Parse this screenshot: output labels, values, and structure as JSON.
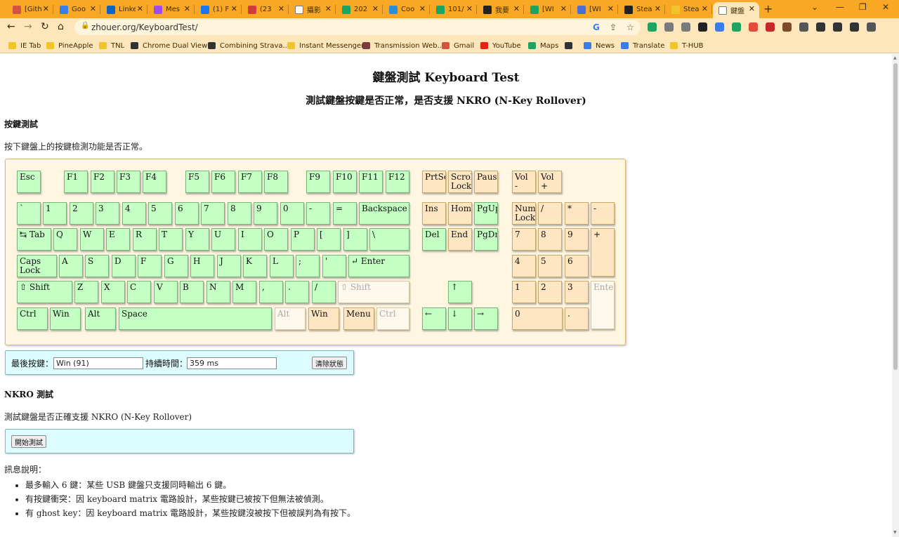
{
  "browser": {
    "tabs": [
      {
        "title": "[Gith",
        "color": "#d4523f"
      },
      {
        "title": "Goo",
        "color": "#3b7de8"
      },
      {
        "title": "Linke",
        "color": "#0a66c2"
      },
      {
        "title": "Mes",
        "color": "#a04bf0"
      },
      {
        "title": "(1) F",
        "color": "#1877f2"
      },
      {
        "title": "(23",
        "color": "#d23c3c"
      },
      {
        "title": "攝影",
        "color": "#ffffff"
      },
      {
        "title": "202",
        "color": "#1ea362"
      },
      {
        "title": "Coo",
        "color": "#2b8fd6"
      },
      {
        "title": "101/",
        "color": "#1ea362"
      },
      {
        "title": "我要",
        "color": "#222222"
      },
      {
        "title": "[WI",
        "color": "#1ea362"
      },
      {
        "title": "[WI",
        "color": "#4a6fd8"
      },
      {
        "title": "Stea",
        "color": "#222222"
      },
      {
        "title": "Stea",
        "color": "#f2c42b"
      },
      {
        "title": "鍵盤",
        "color": "#ffffff",
        "active": true
      }
    ],
    "url": "zhouer.org/KeyboardTest/",
    "bookmarks": [
      {
        "label": "IE Tab",
        "color": "#f2c42b"
      },
      {
        "label": "PineApple",
        "color": "#f2c42b"
      },
      {
        "label": "TNL",
        "color": "#f2c42b"
      },
      {
        "label": "Chrome Dual View",
        "color": "#333333"
      },
      {
        "label": "Combining Strava...",
        "color": "#333333"
      },
      {
        "label": "Instant Messenger",
        "color": "#f2c42b"
      },
      {
        "label": "Transmission Web...",
        "color": "#7a3c3c"
      },
      {
        "label": "Gmail",
        "color": "#d4523f"
      },
      {
        "label": "YouTube",
        "color": "#e62117"
      },
      {
        "label": "Maps",
        "color": "#1ea362"
      },
      {
        "label": "",
        "color": "#333333"
      },
      {
        "label": "News",
        "color": "#3b7de8"
      },
      {
        "label": "Translate",
        "color": "#3b7de8"
      },
      {
        "label": "T-HUB",
        "color": "#f2c42b"
      }
    ]
  },
  "page": {
    "title": "鍵盤測試 Keyboard Test",
    "subtitle": "測試鍵盤按鍵是否正常，是否支援 NKRO (N-Key Rollover)",
    "keytest_heading": "按鍵測試",
    "keytest_desc": "按下鍵盤上的按鍵檢測功能是否正常。",
    "status": {
      "last_key_label": "最後按鍵：",
      "last_key_value": "Win (91)",
      "duration_label": "持續時間：",
      "duration_value": "359 ms",
      "clear_button": "清除狀態"
    },
    "nkro_heading": "NKRO 測試",
    "nkro_desc": "測試鍵盤是否正確支援 NKRO (N-Key Rollover)",
    "start_button": "開始測試",
    "info_heading": "訊息說明：",
    "info_items": [
      "最多輸入 6 鍵：某些 USB 鍵盤只支援同時輸出 6 鍵。",
      "有按鍵衝突：因 keyboard matrix 電路設計，某些按鍵已被按下但無法被偵測。",
      "有 ghost key：因 keyboard matrix 電路設計，某些按鍵沒被按下但被誤判為有按下。"
    ]
  },
  "keyboard": {
    "tested_color": "#c4ffc4",
    "untested_color": "#fde6c1",
    "keys": [
      {
        "label": "Esc",
        "state": "tested"
      },
      {
        "label": "F1",
        "state": "tested"
      },
      {
        "label": "F2",
        "state": "tested"
      },
      {
        "label": "F3",
        "state": "tested"
      },
      {
        "label": "F4",
        "state": "tested"
      },
      {
        "label": "F5",
        "state": "tested"
      },
      {
        "label": "F6",
        "state": "tested"
      },
      {
        "label": "F7",
        "state": "tested"
      },
      {
        "label": "F8",
        "state": "tested"
      },
      {
        "label": "F9",
        "state": "tested"
      },
      {
        "label": "F10",
        "state": "tested"
      },
      {
        "label": "F11",
        "state": "tested"
      },
      {
        "label": "F12",
        "state": "tested"
      },
      {
        "label": "PrtSc",
        "state": "untested"
      },
      {
        "label": "Scroll\nLock",
        "state": "untested"
      },
      {
        "label": "Pause",
        "state": "untested"
      },
      {
        "label": "Vol -",
        "state": "untested"
      },
      {
        "label": "Vol +",
        "state": "untested"
      },
      {
        "label": "`",
        "state": "tested"
      },
      {
        "label": "1",
        "state": "tested"
      },
      {
        "label": "2",
        "state": "tested"
      },
      {
        "label": "3",
        "state": "tested"
      },
      {
        "label": "4",
        "state": "tested"
      },
      {
        "label": "5",
        "state": "tested"
      },
      {
        "label": "6",
        "state": "tested"
      },
      {
        "label": "7",
        "state": "tested"
      },
      {
        "label": "8",
        "state": "tested"
      },
      {
        "label": "9",
        "state": "tested"
      },
      {
        "label": "0",
        "state": "tested"
      },
      {
        "label": "-",
        "state": "tested"
      },
      {
        "label": "=",
        "state": "tested"
      },
      {
        "label": "Backspace",
        "state": "tested"
      },
      {
        "label": "Ins",
        "state": "untested"
      },
      {
        "label": "Home",
        "state": "untested"
      },
      {
        "label": "PgUp",
        "state": "tested"
      },
      {
        "label": "Num\nLock",
        "state": "untested"
      },
      {
        "label": "/",
        "state": "untested"
      },
      {
        "label": "*",
        "state": "untested"
      },
      {
        "label": "-",
        "state": "untested"
      },
      {
        "label": "↹ Tab",
        "state": "tested"
      },
      {
        "label": "Q",
        "state": "tested"
      },
      {
        "label": "W",
        "state": "tested"
      },
      {
        "label": "E",
        "state": "tested"
      },
      {
        "label": "R",
        "state": "tested"
      },
      {
        "label": "T",
        "state": "tested"
      },
      {
        "label": "Y",
        "state": "tested"
      },
      {
        "label": "U",
        "state": "tested"
      },
      {
        "label": "I",
        "state": "tested"
      },
      {
        "label": "O",
        "state": "tested"
      },
      {
        "label": "P",
        "state": "tested"
      },
      {
        "label": "[",
        "state": "tested"
      },
      {
        "label": "]",
        "state": "tested"
      },
      {
        "label": "\\",
        "state": "tested"
      },
      {
        "label": "Del",
        "state": "tested"
      },
      {
        "label": "End",
        "state": "untested"
      },
      {
        "label": "PgDn",
        "state": "tested"
      },
      {
        "label": "7",
        "state": "untested"
      },
      {
        "label": "8",
        "state": "untested"
      },
      {
        "label": "9",
        "state": "untested"
      },
      {
        "label": "+",
        "state": "untested"
      },
      {
        "label": "Caps\nLock",
        "state": "tested"
      },
      {
        "label": "A",
        "state": "tested"
      },
      {
        "label": "S",
        "state": "tested"
      },
      {
        "label": "D",
        "state": "tested"
      },
      {
        "label": "F",
        "state": "tested"
      },
      {
        "label": "G",
        "state": "tested"
      },
      {
        "label": "H",
        "state": "tested"
      },
      {
        "label": "J",
        "state": "tested"
      },
      {
        "label": "K",
        "state": "tested"
      },
      {
        "label": "L",
        "state": "tested"
      },
      {
        "label": ";",
        "state": "tested"
      },
      {
        "label": "'",
        "state": "tested"
      },
      {
        "label": "↵ Enter",
        "state": "tested"
      },
      {
        "label": "4",
        "state": "untested"
      },
      {
        "label": "5",
        "state": "untested"
      },
      {
        "label": "6",
        "state": "untested"
      },
      {
        "label": "⇧ Shift",
        "state": "tested"
      },
      {
        "label": "Z",
        "state": "tested"
      },
      {
        "label": "X",
        "state": "tested"
      },
      {
        "label": "C",
        "state": "tested"
      },
      {
        "label": "V",
        "state": "tested"
      },
      {
        "label": "B",
        "state": "tested"
      },
      {
        "label": "N",
        "state": "tested"
      },
      {
        "label": "M",
        "state": "tested"
      },
      {
        "label": ",",
        "state": "tested"
      },
      {
        "label": ".",
        "state": "tested"
      },
      {
        "label": "/",
        "state": "tested"
      },
      {
        "label": "⇧ Shift",
        "state": "untested-faint"
      },
      {
        "label": "↑",
        "state": "tested"
      },
      {
        "label": "1",
        "state": "untested"
      },
      {
        "label": "2",
        "state": "untested"
      },
      {
        "label": "3",
        "state": "untested"
      },
      {
        "label": "Enter",
        "state": "untested-faint"
      },
      {
        "label": "Ctrl",
        "state": "tested"
      },
      {
        "label": "Win",
        "state": "tested"
      },
      {
        "label": "Alt",
        "state": "tested"
      },
      {
        "label": "Space",
        "state": "tested"
      },
      {
        "label": "Alt",
        "state": "untested-faint"
      },
      {
        "label": "Win",
        "state": "untested"
      },
      {
        "label": "Menu",
        "state": "untested"
      },
      {
        "label": "Ctrl",
        "state": "untested-faint"
      },
      {
        "label": "←",
        "state": "tested"
      },
      {
        "label": "↓",
        "state": "tested"
      },
      {
        "label": "→",
        "state": "tested"
      },
      {
        "label": "0",
        "state": "untested"
      },
      {
        "label": ".",
        "state": "untested"
      }
    ]
  }
}
